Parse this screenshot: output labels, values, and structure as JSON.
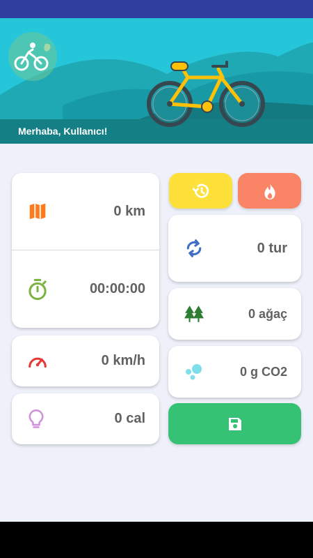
{
  "header": {
    "greeting": "Merhaba, Kullanıcı!"
  },
  "stats": {
    "distance": "0 km",
    "duration": "00:00:00",
    "speed": "0 km/h",
    "calories": "0 cal",
    "laps": "0 tur",
    "trees": "0 ağaç",
    "co2": "0 g CO2"
  },
  "actions": {
    "history_icon": "history-icon",
    "fire_icon": "fire-icon",
    "save_icon": "save-icon"
  },
  "colors": {
    "status_bar": "#303F9F",
    "hero_bg": "#26C6DA",
    "content_bg": "#EEF0FA",
    "history_button": "#FDE03A",
    "fire_button": "#FA8466",
    "save_button": "#36C274"
  }
}
